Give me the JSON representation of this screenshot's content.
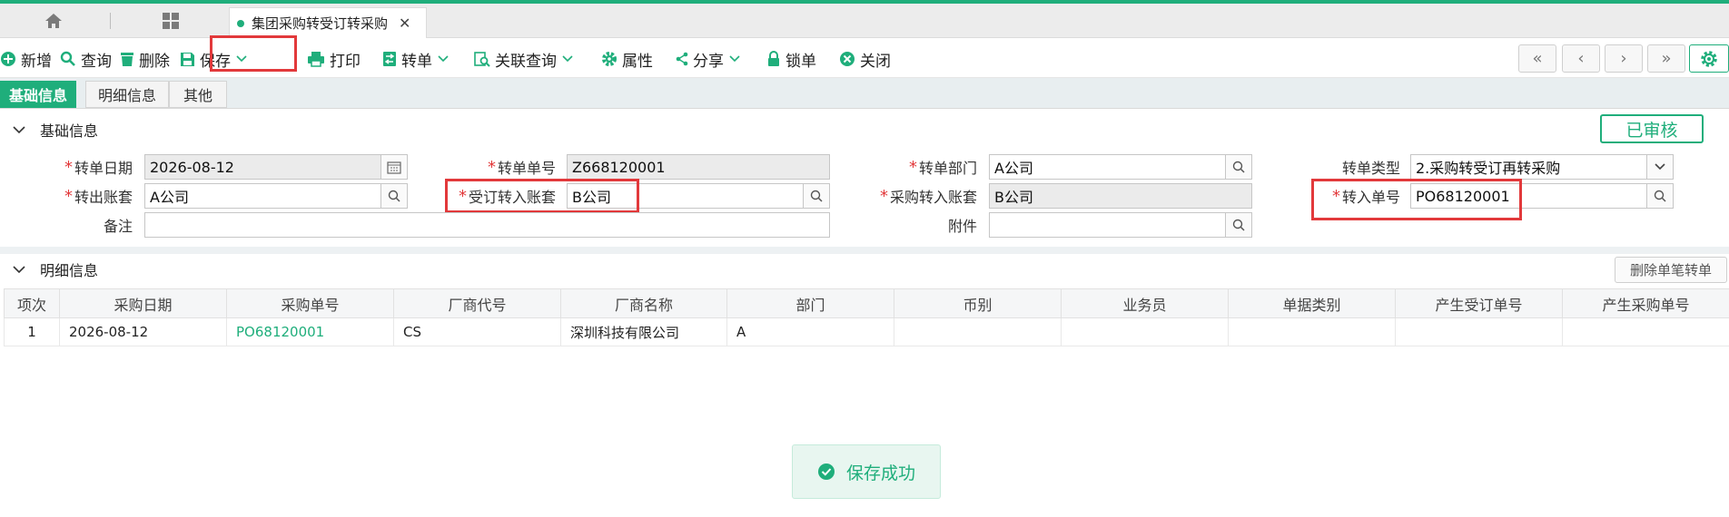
{
  "tabs": {
    "active_title": "集团采购转受订转采购"
  },
  "toolbar": {
    "new": "新增",
    "query": "查询",
    "delete": "删除",
    "save": "保存",
    "print": "打印",
    "transfer": "转单",
    "linked_query": "关联查询",
    "properties": "属性",
    "share": "分享",
    "lock": "锁单",
    "close": "关闭"
  },
  "form_tabs": [
    "基础信息",
    "明细信息",
    "其他"
  ],
  "basic": {
    "section_title": "基础信息",
    "status": "已审核",
    "labels": {
      "date": "转单日期",
      "no": "转单单号",
      "dept": "转单部门",
      "type": "转单类型",
      "out_book": "转出账套",
      "order_in_book": "受订转入账套",
      "purchase_in_book": "采购转入账套",
      "in_no": "转入单号",
      "remark": "备注",
      "attachment": "附件"
    },
    "values": {
      "date": "2026-08-12",
      "no": "Z668120001",
      "dept": "A公司",
      "type": "2.采购转受订再转采购",
      "out_book": "A公司",
      "order_in_book": "B公司",
      "purchase_in_book": "B公司",
      "in_no": "PO68120001",
      "remark": "",
      "attachment": ""
    }
  },
  "detail": {
    "section_title": "明细信息",
    "delete_single": "删除单笔转单",
    "columns": [
      "项次",
      "采购日期",
      "采购单号",
      "厂商代号",
      "厂商名称",
      "部门",
      "币别",
      "业务员",
      "单据类别",
      "产生受订单号",
      "产生采购单号"
    ],
    "rows": [
      {
        "idx": "1",
        "date": "2026-08-12",
        "po": "PO68120001",
        "vendor_code": "CS",
        "vendor_name": "深圳科技有限公司",
        "dept": "A",
        "currency": "",
        "salesman": "",
        "doc_type": "",
        "order_no": "",
        "purchase_no": ""
      }
    ]
  },
  "toast": {
    "message": "保存成功"
  },
  "colors": {
    "accent": "#1fae7b",
    "highlight": "#e2393b"
  }
}
